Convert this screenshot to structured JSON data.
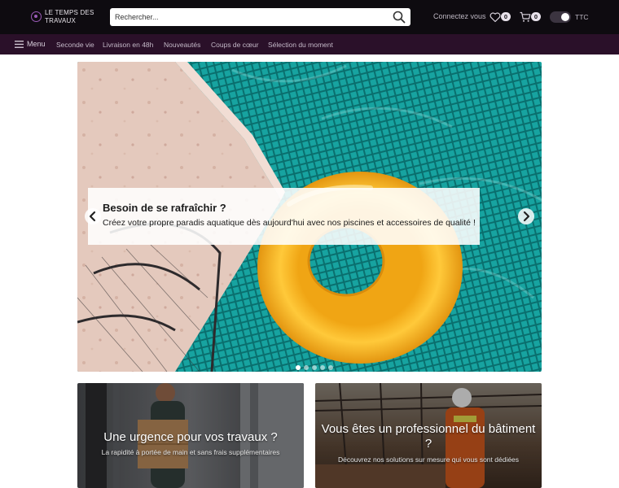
{
  "header": {
    "logo_text": "Le Temps des Travaux",
    "search": {
      "placeholder": "Rechercher...",
      "value": ""
    },
    "account_label": "Connectez vous",
    "wishlist_count": "0",
    "cart_count": "0",
    "tax_toggle_label": "TTC",
    "icons": [
      "search-icon",
      "heart-icon",
      "cart-icon"
    ]
  },
  "navbar": {
    "menu_label": "Menu",
    "items": [
      "Seconde vie",
      "Livraison en 48h",
      "Nouveautés",
      "Coups de cœur",
      "Sélection du moment"
    ]
  },
  "hero": {
    "title": "Besoin de se rafraîchir ?",
    "subtitle": "Créez votre propre paradis aquatique dès aujourd'hui avec nos piscines et accessoires de qualité !",
    "slide_count": 5,
    "active_slide": 1
  },
  "promos": [
    {
      "title": "Une urgence pour vos travaux ?",
      "subtitle": "La rapidité à portée de main et sans frais supplémentaires"
    },
    {
      "title": "Vous êtes un professionnel du bâtiment ?",
      "subtitle": "Découvrez nos solutions sur mesure qui vous sont dédiées"
    }
  ],
  "colors": {
    "topbar": "#0e0b10",
    "navbar": "#2a1029",
    "pool": "#0f8f8c",
    "float": "#f6b21a",
    "accent": "#9a5bb7"
  }
}
